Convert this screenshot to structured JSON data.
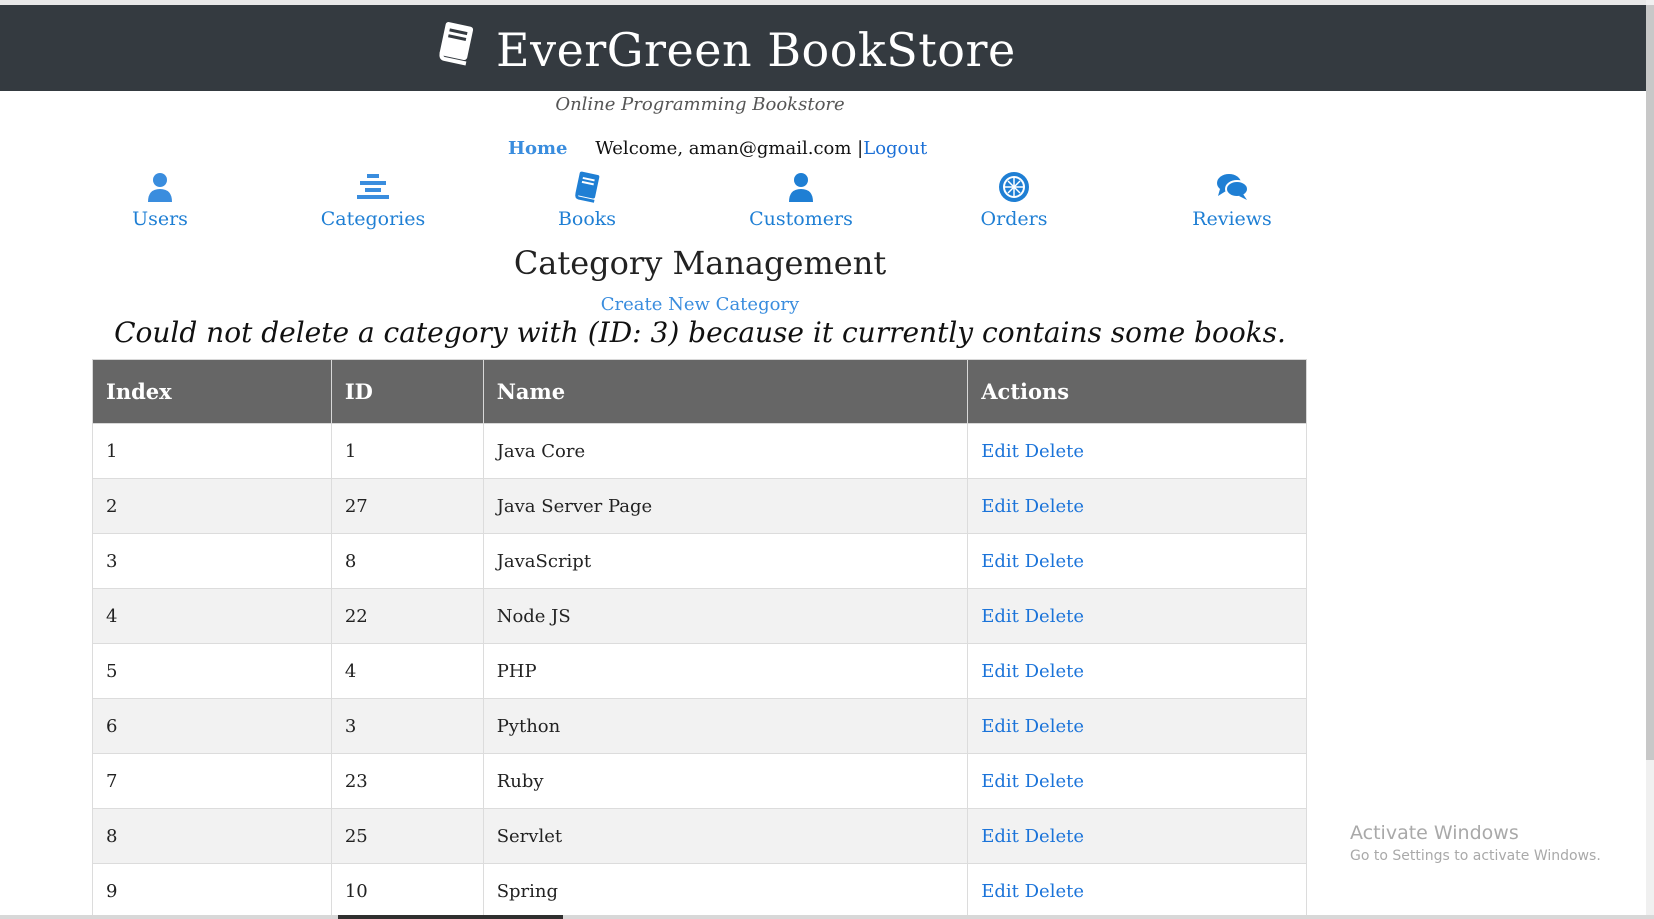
{
  "header": {
    "title": "EverGreen BookStore",
    "logo_icon": "book-icon"
  },
  "tagline": "Online Programming Bookstore",
  "topnav": {
    "home": "Home",
    "welcome": "Welcome, aman@gmail.com |",
    "logout": "Logout"
  },
  "menu": [
    {
      "label": "Users",
      "icon": "user-icon"
    },
    {
      "label": "Categories",
      "icon": "bars-icon"
    },
    {
      "label": "Books",
      "icon": "book-icon"
    },
    {
      "label": "Customers",
      "icon": "user-icon"
    },
    {
      "label": "Orders",
      "icon": "order-icon"
    },
    {
      "label": "Reviews",
      "icon": "comments-icon"
    }
  ],
  "page_title": "Category Management",
  "create_link": "Create New Category",
  "message": "Could not delete a category with (ID: 3) because it currently contains some books.",
  "table": {
    "headers": [
      "Index",
      "ID",
      "Name",
      "Actions"
    ],
    "edit_label": "Edit",
    "delete_label": "Delete",
    "rows": [
      {
        "index": "1",
        "id": "1",
        "name": "Java Core"
      },
      {
        "index": "2",
        "id": "27",
        "name": "Java Server Page"
      },
      {
        "index": "3",
        "id": "8",
        "name": "JavaScript"
      },
      {
        "index": "4",
        "id": "22",
        "name": "Node JS"
      },
      {
        "index": "5",
        "id": "4",
        "name": "PHP"
      },
      {
        "index": "6",
        "id": "3",
        "name": "Python"
      },
      {
        "index": "7",
        "id": "23",
        "name": "Ruby"
      },
      {
        "index": "8",
        "id": "25",
        "name": "Servlet"
      },
      {
        "index": "9",
        "id": "10",
        "name": "Spring"
      }
    ]
  },
  "watermark": {
    "line1": "Activate Windows",
    "line2": "Go to Settings to activate Windows."
  },
  "colors": {
    "header_bg": "#343a40",
    "link": "#1a73d9",
    "table_header_bg": "#666666"
  }
}
